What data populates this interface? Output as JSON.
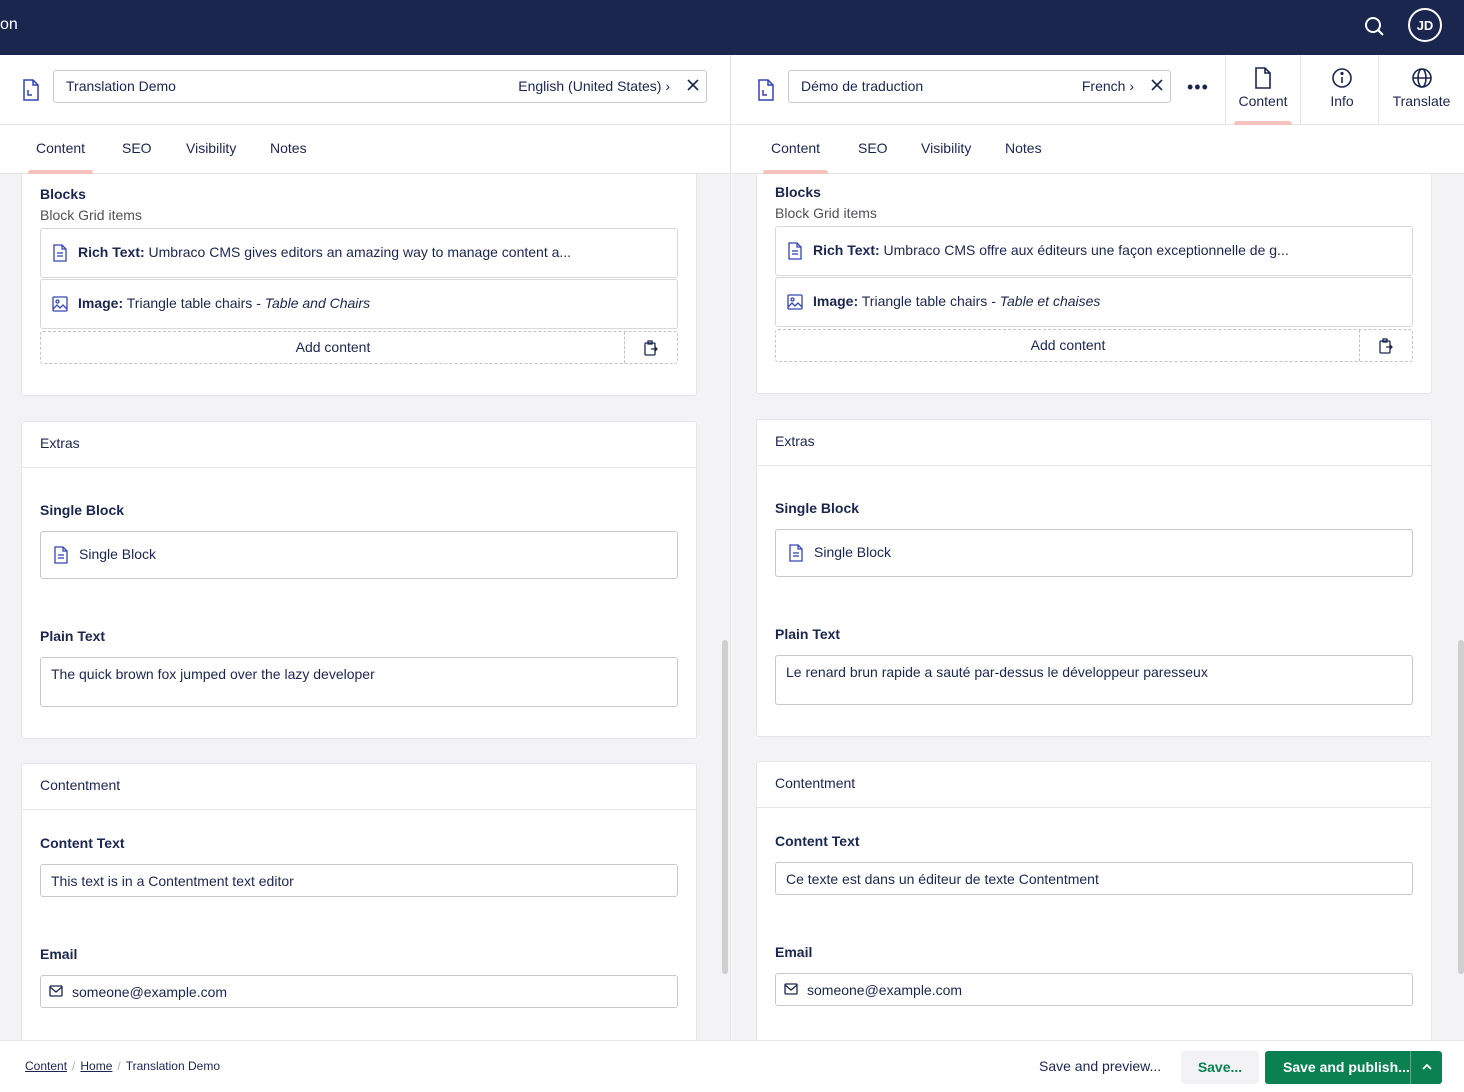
{
  "topbar": {
    "app_fragment": "on",
    "avatar_initials": "JD"
  },
  "left": {
    "name": "Translation Demo",
    "language": "English (United States)",
    "tabs": [
      "Content",
      "SEO",
      "Visibility",
      "Notes"
    ],
    "blocks": {
      "label": "Blocks",
      "description": "Block Grid items",
      "rich_text_type": "Rich Text:",
      "rich_text_value": " Umbraco CMS gives editors an amazing way to manage content a...",
      "image_type": "Image:",
      "image_value": " Triangle table chairs - ",
      "image_caption": "Table and Chairs",
      "add_content": "Add content"
    },
    "extras": {
      "title": "Extras",
      "single_block_label": "Single Block",
      "single_block_value": "Single Block",
      "plain_text_label": "Plain Text",
      "plain_text_value": "The quick brown fox jumped over the lazy developer"
    },
    "contentment": {
      "title": "Contentment",
      "content_text_label": "Content Text",
      "content_text_value": "This text is in a Contentment text editor",
      "email_label": "Email",
      "email_value": "someone@example.com"
    }
  },
  "right": {
    "name": "Démo de traduction",
    "language": "French",
    "tabs": [
      "Content",
      "SEO",
      "Visibility",
      "Notes"
    ],
    "views": [
      "Content",
      "Info",
      "Translate"
    ],
    "blocks": {
      "label": "Blocks",
      "description": "Block Grid items",
      "rich_text_type": "Rich Text:",
      "rich_text_value": " Umbraco CMS offre aux éditeurs une façon exceptionnelle de g...",
      "image_type": "Image:",
      "image_value": " Triangle table chairs - ",
      "image_caption": "Table et chaises",
      "add_content": "Add content"
    },
    "extras": {
      "title": "Extras",
      "single_block_label": "Single Block",
      "single_block_value": "Single Block",
      "plain_text_label": "Plain Text",
      "plain_text_value": "Le renard brun rapide a sauté par-dessus le développeur paresseux"
    },
    "contentment": {
      "title": "Contentment",
      "content_text_label": "Content Text",
      "content_text_value": "Ce texte est dans un éditeur de texte Contentment",
      "email_label": "Email",
      "email_value": "someone@example.com"
    }
  },
  "footer": {
    "breadcrumbs": [
      "Content",
      "Home",
      "Translation Demo"
    ],
    "save_preview": "Save and preview...",
    "save": "Save...",
    "save_publish": "Save and publish..."
  },
  "colors": {
    "topbar": "#1b264f",
    "primary_green": "#0b8152",
    "tab_indicator": "#f5c1bc"
  }
}
